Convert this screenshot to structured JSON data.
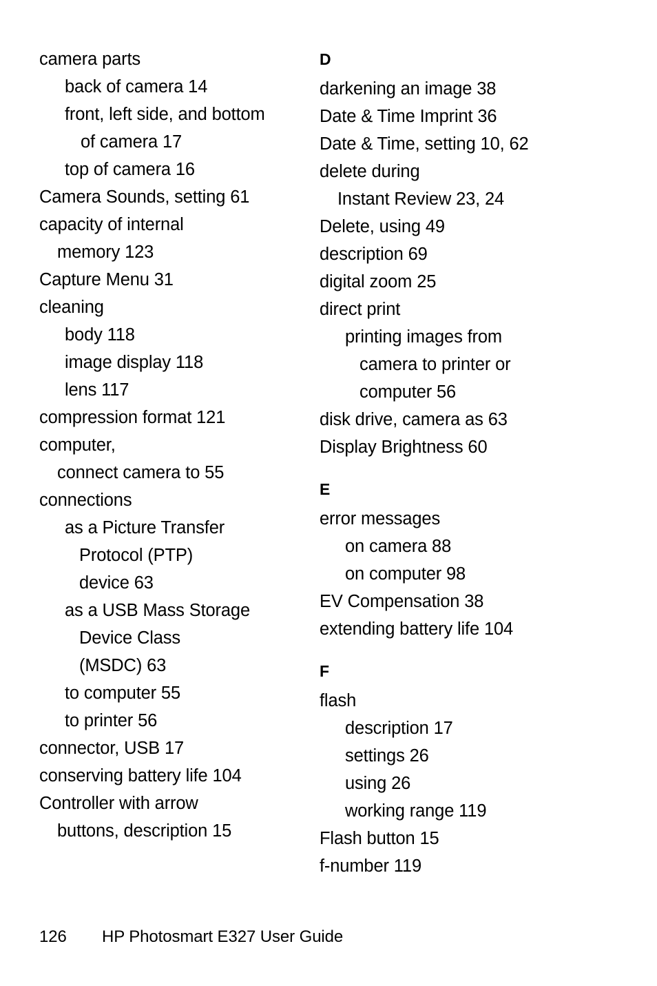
{
  "page": {
    "footer_page_number": "126",
    "footer_title": "HP Photosmart E327 User Guide"
  },
  "index": {
    "left_column": [
      {
        "type": "entry",
        "indent": "lvl0",
        "text": "camera parts"
      },
      {
        "type": "entry",
        "indent": "lvl1",
        "text": "back of camera  14"
      },
      {
        "type": "entry",
        "indent": "lvl1",
        "text": "front, left side, and bottom"
      },
      {
        "type": "entry",
        "indent": "lvl2",
        "text": "of camera  17"
      },
      {
        "type": "entry",
        "indent": "lvl1",
        "text": "top of camera  16"
      },
      {
        "type": "entry",
        "indent": "lvl0",
        "text": "Camera Sounds, setting  61"
      },
      {
        "type": "entry",
        "indent": "lvl0",
        "text": "capacity of internal"
      },
      {
        "type": "entry",
        "indent": "lvl-cont",
        "text": "memory  123"
      },
      {
        "type": "entry",
        "indent": "lvl0",
        "text": "Capture Menu  31"
      },
      {
        "type": "entry",
        "indent": "lvl0",
        "text": "cleaning"
      },
      {
        "type": "entry",
        "indent": "lvl1",
        "text": "body  118"
      },
      {
        "type": "entry",
        "indent": "lvl1",
        "text": "image display  118"
      },
      {
        "type": "entry",
        "indent": "lvl1",
        "text": "lens  117"
      },
      {
        "type": "entry",
        "indent": "lvl0",
        "text": "compression format  121"
      },
      {
        "type": "entry",
        "indent": "lvl0",
        "text": "computer,"
      },
      {
        "type": "entry",
        "indent": "lvl-cont",
        "text": "connect camera to  55"
      },
      {
        "type": "entry",
        "indent": "lvl0",
        "text": "connections"
      },
      {
        "type": "entry",
        "indent": "lvl1",
        "text": "as a Picture Transfer"
      },
      {
        "type": "entry",
        "indent": "lvl1-cont",
        "text": "Protocol (PTP)"
      },
      {
        "type": "entry",
        "indent": "lvl1-cont",
        "text": "device  63"
      },
      {
        "type": "entry",
        "indent": "lvl1",
        "text": "as a USB Mass Storage"
      },
      {
        "type": "entry",
        "indent": "lvl1-cont",
        "text": "Device Class"
      },
      {
        "type": "entry",
        "indent": "lvl1-cont",
        "text": "(MSDC)  63"
      },
      {
        "type": "entry",
        "indent": "lvl1",
        "text": "to computer  55"
      },
      {
        "type": "entry",
        "indent": "lvl1",
        "text": "to printer  56"
      },
      {
        "type": "entry",
        "indent": "lvl0",
        "text": "connector, USB  17"
      },
      {
        "type": "entry",
        "indent": "lvl0",
        "text": "conserving battery life  104"
      },
      {
        "type": "entry",
        "indent": "lvl0",
        "text": "Controller with arrow"
      },
      {
        "type": "entry",
        "indent": "lvl-cont",
        "text": "buttons, description  15"
      }
    ],
    "right_column": [
      {
        "type": "heading",
        "indent": "lvl0",
        "text": "D"
      },
      {
        "type": "entry",
        "indent": "lvl0",
        "text": "darkening an image  38"
      },
      {
        "type": "entry",
        "indent": "lvl0",
        "text": "Date & Time Imprint  36"
      },
      {
        "type": "entry",
        "indent": "lvl0",
        "text": "Date & Time, setting  10,  62"
      },
      {
        "type": "entry",
        "indent": "lvl0",
        "text": "delete during"
      },
      {
        "type": "entry",
        "indent": "lvl-cont",
        "text": "Instant Review  23,  24"
      },
      {
        "type": "entry",
        "indent": "lvl0",
        "text": "Delete, using  49"
      },
      {
        "type": "entry",
        "indent": "lvl0",
        "text": "description  69"
      },
      {
        "type": "entry",
        "indent": "lvl0",
        "text": "digital zoom  25"
      },
      {
        "type": "entry",
        "indent": "lvl0",
        "text": "direct print"
      },
      {
        "type": "entry",
        "indent": "lvl1",
        "text": "printing images from"
      },
      {
        "type": "entry",
        "indent": "lvl1-cont",
        "text": "camera to printer or"
      },
      {
        "type": "entry",
        "indent": "lvl1-cont",
        "text": "computer  56"
      },
      {
        "type": "entry",
        "indent": "lvl0",
        "text": "disk drive, camera as  63"
      },
      {
        "type": "entry",
        "indent": "lvl0",
        "text": "Display Brightness  60"
      },
      {
        "type": "heading",
        "indent": "lvl0",
        "text": "E"
      },
      {
        "type": "entry",
        "indent": "lvl0",
        "text": "error messages"
      },
      {
        "type": "entry",
        "indent": "lvl1",
        "text": "on camera  88"
      },
      {
        "type": "entry",
        "indent": "lvl1",
        "text": "on computer  98"
      },
      {
        "type": "entry",
        "indent": "lvl0",
        "text": "EV Compensation  38"
      },
      {
        "type": "entry",
        "indent": "lvl0",
        "text": "extending battery life  104"
      },
      {
        "type": "heading",
        "indent": "lvl0",
        "text": "F"
      },
      {
        "type": "entry",
        "indent": "lvl0",
        "text": "flash"
      },
      {
        "type": "entry",
        "indent": "lvl1",
        "text": "description  17"
      },
      {
        "type": "entry",
        "indent": "lvl1",
        "text": "settings  26"
      },
      {
        "type": "entry",
        "indent": "lvl1",
        "text": "using  26"
      },
      {
        "type": "entry",
        "indent": "lvl1",
        "text": "working range  119"
      },
      {
        "type": "entry",
        "indent": "lvl0",
        "text": "Flash button  15"
      },
      {
        "type": "entry",
        "indent": "lvl0",
        "text": "f-number  119"
      }
    ]
  }
}
